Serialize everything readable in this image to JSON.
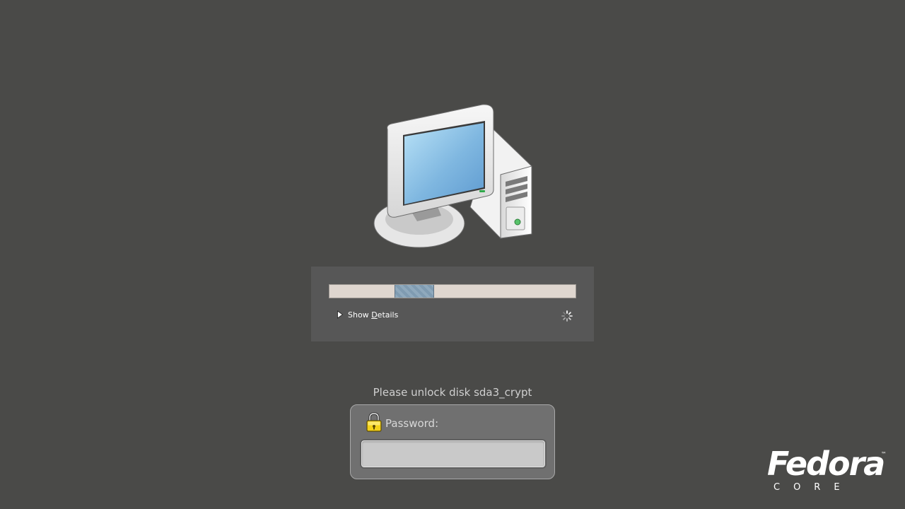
{
  "boot": {
    "progress": {
      "mode": "indeterminate",
      "pulse_start": 0.265,
      "pulse_width": 0.16
    },
    "details_toggle": {
      "label_before": "Show ",
      "label_mnemonic": "D",
      "label_after": "etails",
      "expanded": false
    }
  },
  "unlock": {
    "prompt": "Please unlock disk sda3_crypt",
    "password_label": "Password:",
    "password_value": ""
  },
  "branding": {
    "name": "Fedora",
    "trademark": "™",
    "sub": "CORE"
  },
  "icons": {
    "illustration": "computer-icon",
    "expander": "triangle-right-icon",
    "spinner": "spinner-icon",
    "lock": "padlock-icon"
  },
  "colors": {
    "background": "#4a4a48",
    "panel": "#575757",
    "track": "#dfd6cf",
    "pulse": "#8fa9bd",
    "password_box": "#707070"
  }
}
